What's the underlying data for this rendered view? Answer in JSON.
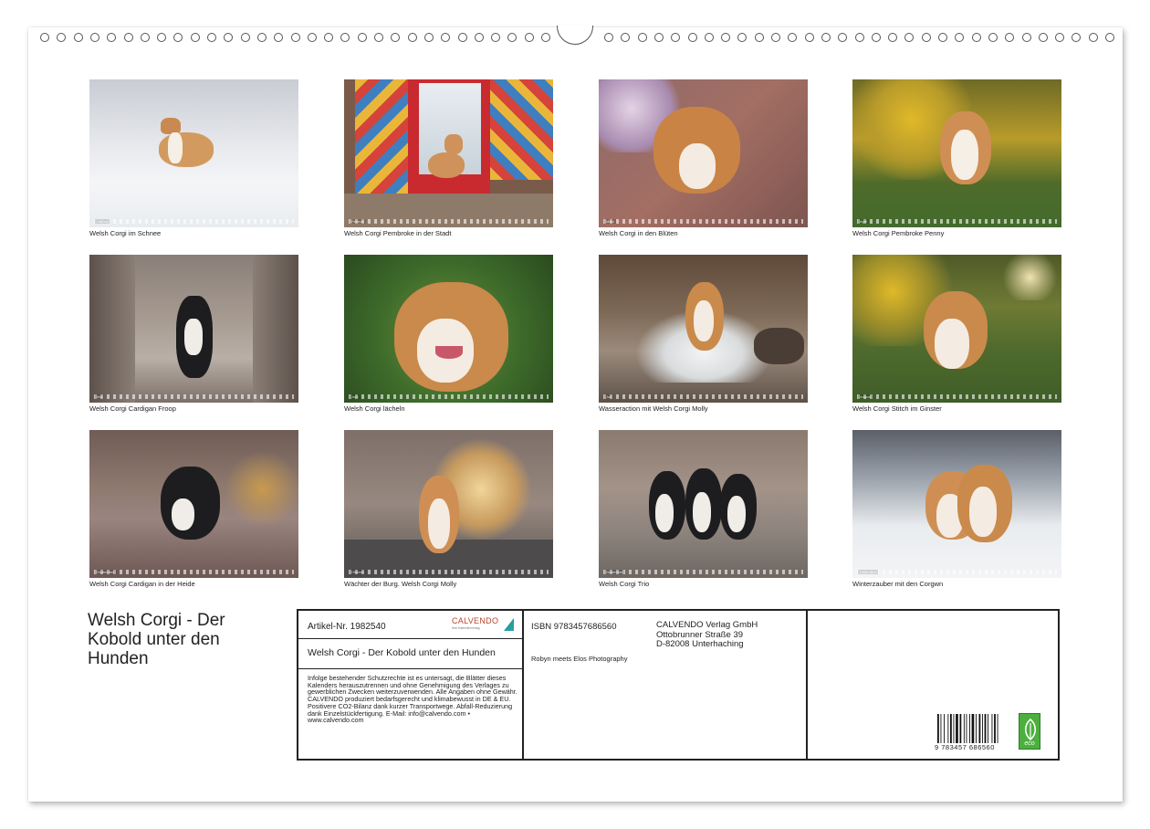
{
  "calendar": {
    "title": "Welsh Corgi - Der Kobold unter den Hunden",
    "photos": [
      {
        "caption": "Welsh Corgi im Schnee",
        "month": "Januar"
      },
      {
        "caption": "Welsh Corgi Pembroke in der Stadt",
        "month": "Februar"
      },
      {
        "caption": "Welsh Corgi in den Blüten",
        "month": "März"
      },
      {
        "caption": "Welsh Corgi Pembroke Penny",
        "month": "April"
      },
      {
        "caption": "Welsh Corgi Cardigan  Froop",
        "month": "Mai"
      },
      {
        "caption": "Welsh Corgi lächeln",
        "month": "Juni"
      },
      {
        "caption": "Wasseraction mit Welsh Corgi Molly",
        "month": "Juli"
      },
      {
        "caption": "Welsh Corgi Stitch im Ginster",
        "month": "August"
      },
      {
        "caption": "Welsh Corgi Cardigan in der Heide",
        "month": "September"
      },
      {
        "caption": "Wächter der Burg. Welsh Corgi Molly",
        "month": "Oktober"
      },
      {
        "caption": "Welsh Corgi Trio",
        "month": "November"
      },
      {
        "caption": "Winterzauber mit den Corgwn",
        "month": "Dezember"
      }
    ]
  },
  "info": {
    "artikel": "Artikel-Nr. 1982540",
    "brand": "CALVENDO",
    "brand_sub": "Ihre Kalenderverlag",
    "subtitle": "Welsh Corgi - Der Kobold unter den Hunden",
    "legal": "Infolge bestehender Schutzrechte ist es untersagt, die Blätter dieses Kalenders herauszutrennen und ohne Genehmigung des Verlages zu gewerblichen Zwecken weiterzuverwenden. Alle Angaben ohne Gewähr. CALVENDO produziert bedarfsgerecht und klimabewusst in DE & EU. Positivere CO2-Bilanz dank kurzer Transportwege. Abfall-Reduzierung dank Einzelstückfertigung. E-Mail: info@calvendo.com • www.calvendo.com",
    "isbn": "ISBN 9783457686560",
    "publisher_name": "CALVENDO Verlag GmbH",
    "publisher_street": "Ottobrunner Straße 39",
    "publisher_city": "D-82008 Unterhaching",
    "author": "Robyn meets Elos Photography",
    "barcode_number": "9 783457 686560",
    "eco_label": "eco"
  },
  "colors": {
    "brand": "#b4472b",
    "eco_green": "#4caf3e"
  }
}
